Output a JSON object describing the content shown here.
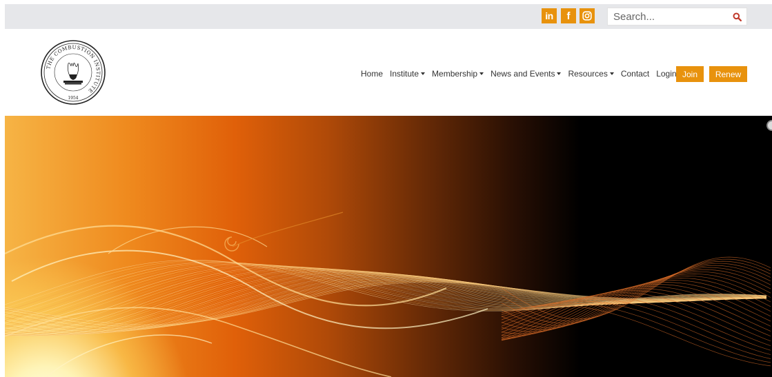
{
  "topbar": {
    "social": [
      {
        "name": "linkedin-icon",
        "label": "in"
      },
      {
        "name": "facebook-icon",
        "label": "f"
      },
      {
        "name": "instagram-icon",
        "label": ""
      }
    ],
    "search": {
      "placeholder": "Search...",
      "value": ""
    }
  },
  "header": {
    "logo": {
      "ring_text": "THE COMBUSTION INSTITUTE",
      "year": "1954"
    },
    "nav": {
      "items": [
        {
          "label": "Home",
          "dropdown": false
        },
        {
          "label": "Institute",
          "dropdown": true
        },
        {
          "label": "Membership",
          "dropdown": true
        },
        {
          "label": "News and Events",
          "dropdown": true
        },
        {
          "label": "Resources",
          "dropdown": true
        },
        {
          "label": "Contact",
          "dropdown": false
        },
        {
          "label": "Login",
          "dropdown": false
        }
      ],
      "join_label": "Join",
      "renew_label": "Renew"
    }
  },
  "colors": {
    "accent": "#e8920d",
    "topbar_bg": "#e6e7ea",
    "nav_text": "#333333",
    "search_icon": "#c0392b"
  },
  "icons": {
    "search": "magnifier-icon",
    "caret": "caret-down-icon",
    "slider": "slider-dot-icon"
  }
}
